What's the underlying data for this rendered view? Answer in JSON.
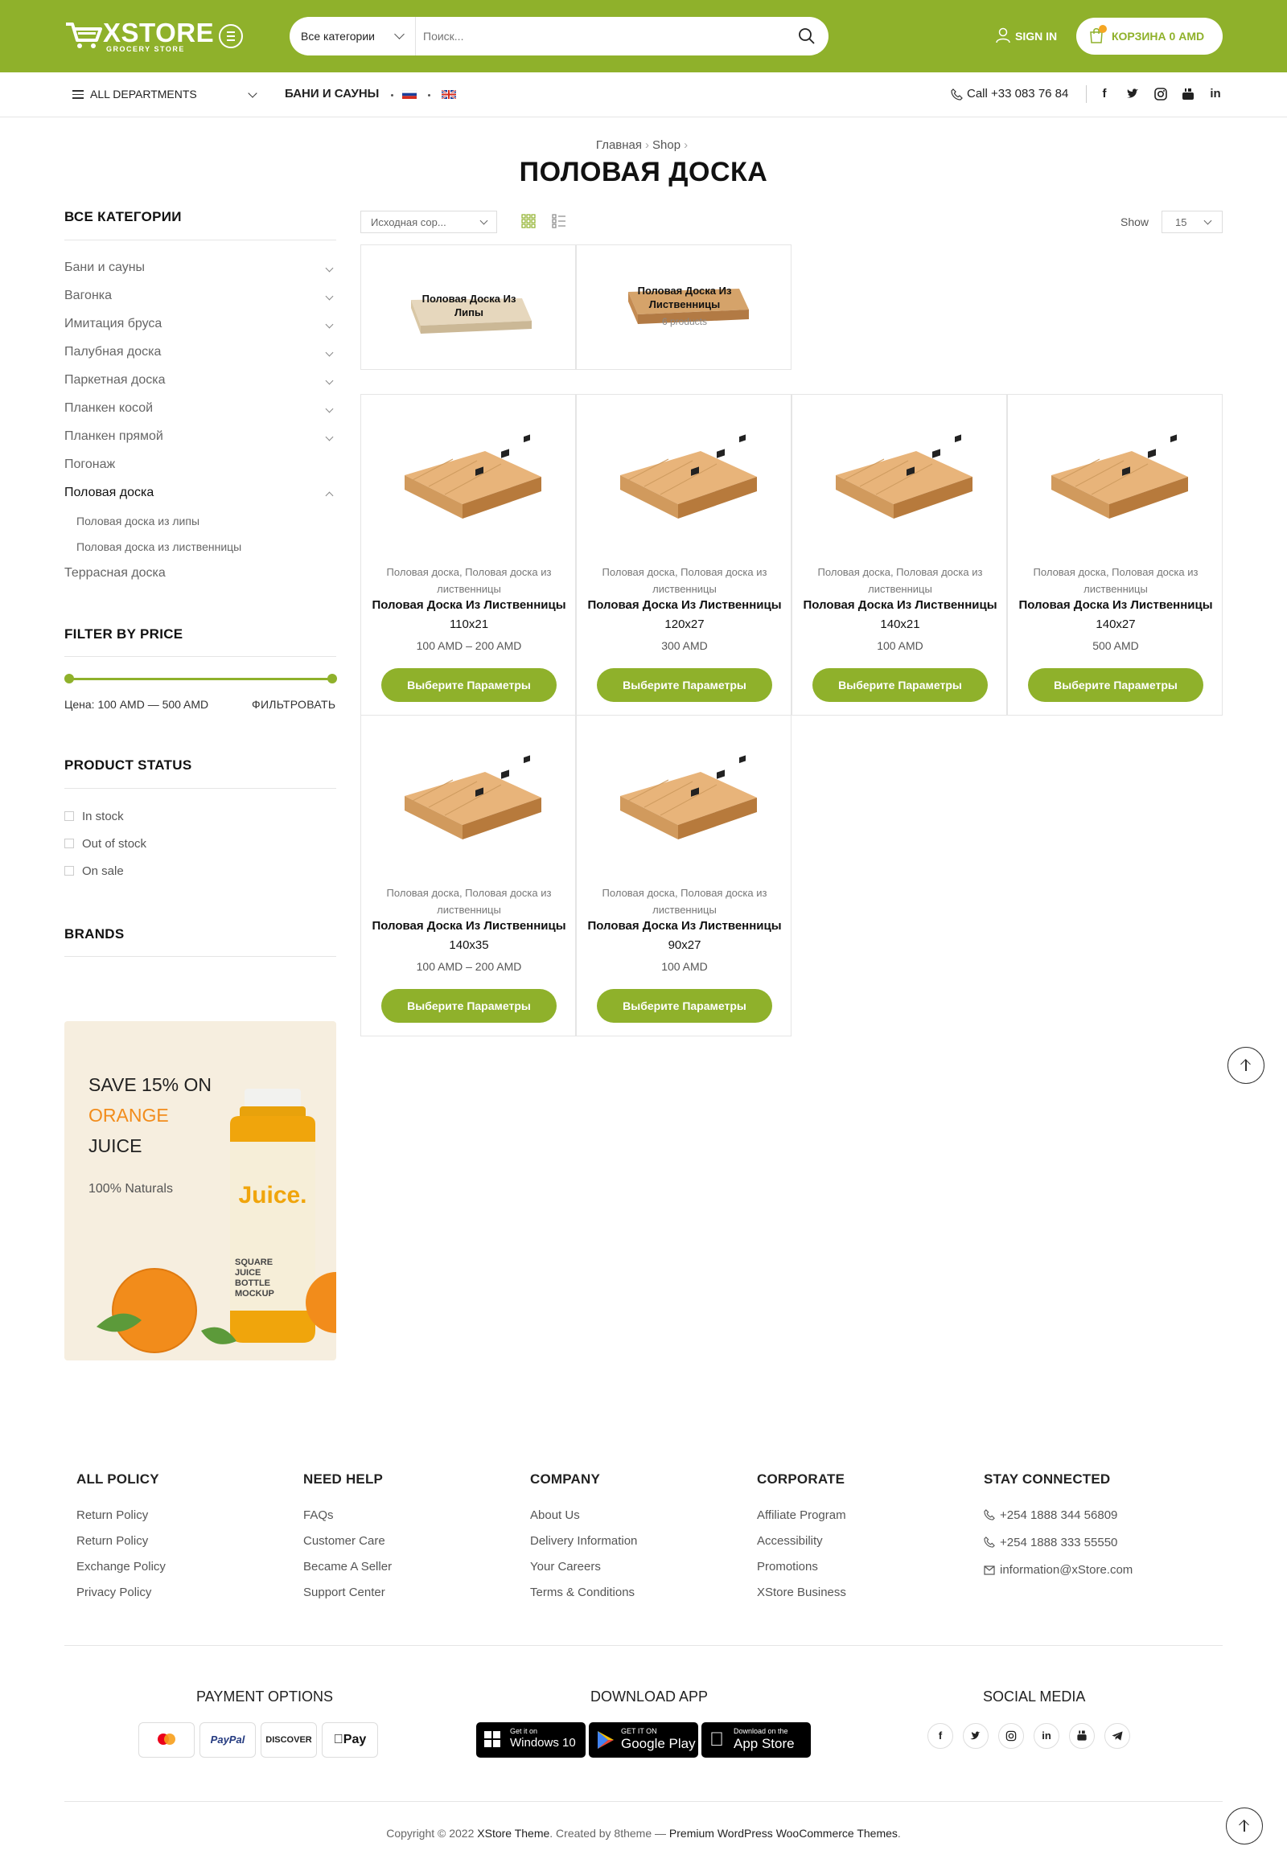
{
  "header": {
    "logo_brand": "XSTORE",
    "logo_sub": "GROCERY STORE",
    "search_category": "Все категории",
    "search_placeholder": "Поиск...",
    "signin": "SIGN IN",
    "cart": "КОРЗИНА 0 AMD"
  },
  "nav": {
    "all_departments": "ALL DEPARTMENTS",
    "link": "БАНИ И САУНЫ",
    "phone": "Call +33 083 76 84",
    "social": [
      "f",
      "t",
      "ig",
      "yt",
      "in"
    ]
  },
  "breadcrumb": {
    "home": "Главная",
    "shop": "Shop"
  },
  "page_title": "ПОЛОВАЯ ДОСКА",
  "sidebar": {
    "categories_title": "ВСЕ КАТЕГОРИИ",
    "categories": [
      "Бани и сауны",
      "Вагонка",
      "Имитация бруса",
      "Палубная доска",
      "Паркетная доска",
      "Планкен косой",
      "Планкен прямой",
      "Погонаж",
      "Половая доска",
      "Террасная доска"
    ],
    "subcategories": [
      "Половая доска из липы",
      "Половая доска из лиственницы"
    ],
    "filter_title": "FILTER BY PRICE",
    "price_text": "Цена: 100 AMD — 500 AMD",
    "filter_button": "ФИЛЬТРОВАТЬ",
    "status_title": "PRODUCT STATUS",
    "status": [
      "In stock",
      "Out of stock",
      "On sale"
    ],
    "brands_title": "BRANDS"
  },
  "promo": {
    "l1": "SAVE 15% ON",
    "l2": "ORANGE",
    "l3": "JUICE",
    "l4": "100% Naturals",
    "bottle_label": "Juice.",
    "bottle_text": "SQUARE JUICE BOTTLE MOCKUP"
  },
  "toolbar": {
    "sort": "Исходная сор...",
    "show_label": "Show",
    "show_value": "15"
  },
  "category_cards": [
    {
      "label": "Половая Доска Из Липы"
    },
    {
      "label": "Половая Доска Из Лиственницы",
      "count": "6 products"
    }
  ],
  "products": [
    {
      "cats": "Половая доска, Половая доска из лиственницы",
      "name": "Половая Доска Из Лиственницы",
      "size": "110x21",
      "price": "100 AMD – 200 AMD",
      "button": "Выберите Параметры"
    },
    {
      "cats": "Половая доска, Половая доска из лиственницы",
      "name": "Половая Доска Из Лиственницы",
      "size": "120x27",
      "price": "300 AMD",
      "button": "Выберите Параметры"
    },
    {
      "cats": "Половая доска, Половая доска из лиственницы",
      "name": "Половая Доска Из Лиственницы",
      "size": "140x21",
      "price": "100 AMD",
      "button": "Выберите Параметры"
    },
    {
      "cats": "Половая доска, Половая доска из лиственницы",
      "name": "Половая Доска Из Лиственницы",
      "size": "140x27",
      "price": "500 AMD",
      "button": "Выберите Параметры"
    },
    {
      "cats": "Половая доска, Половая доска из лиственницы",
      "name": "Половая Доска Из Лиственницы",
      "size": "140x35",
      "price": "100 AMD – 200 AMD",
      "button": "Выберите Параметры"
    },
    {
      "cats": "Половая доска, Половая доска из лиственницы",
      "name": "Половая Доска Из Лиственницы",
      "size": "90x27",
      "price": "100 AMD",
      "button": "Выберите Параметры"
    }
  ],
  "footer": {
    "columns": [
      {
        "title": "ALL POLICY",
        "links": [
          "Return Policy",
          "Return Policy",
          "Exchange Policy",
          "Privacy Policy"
        ]
      },
      {
        "title": "NEED HELP",
        "links": [
          "FAQs",
          "Customer Care",
          "Became A Seller",
          "Support Center"
        ]
      },
      {
        "title": "COMPANY",
        "links": [
          "About Us",
          "Delivery Information",
          "Your Careers",
          "Terms & Conditions"
        ]
      },
      {
        "title": "CORPORATE",
        "links": [
          "Affiliate Program",
          "Accessibility",
          "Promotions",
          "XStore Business"
        ]
      },
      {
        "title": "STAY CONNECTED",
        "links": [
          "+254 1888 344 56809",
          "+254 1888 333 55550",
          "information@xStore.com"
        ]
      }
    ],
    "payment_title": "PAYMENT OPTIONS",
    "payments": [
      "",
      "PayPal",
      "DISCOVER",
      "Pay"
    ],
    "app_title": "DOWNLOAD APP",
    "apps": [
      {
        "small": "Get it on",
        "big": "Windows 10"
      },
      {
        "small": "GET IT ON",
        "big": "Google Play"
      },
      {
        "small": "Download on the",
        "big": "App Store"
      }
    ],
    "social_title": "SOCIAL MEDIA",
    "social": [
      "f",
      "t",
      "ig",
      "in",
      "yt",
      "tg"
    ],
    "copyright_a": "Copyright © 2022 ",
    "copyright_b": "XStore Theme",
    "copyright_c": ". Created by 8theme — ",
    "copyright_d": "Premium WordPress WooCommerce Themes",
    "copyright_e": "."
  },
  "colors": {
    "accent": "#8fb12b",
    "orange": "#f28c1b"
  }
}
